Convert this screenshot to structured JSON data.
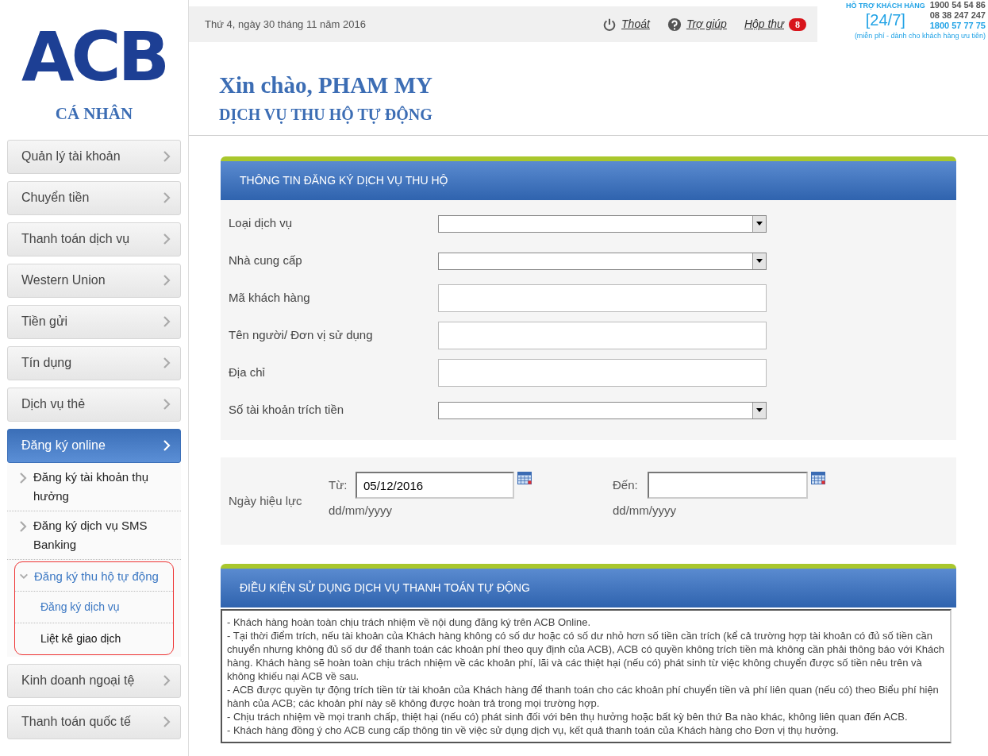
{
  "logo": {
    "text": "ACB",
    "caption": "CÁ NHÂN"
  },
  "top_bar": {
    "date": "Thứ 4, ngày 30 tháng 11 năm 2016",
    "links": [
      {
        "kind": "logout",
        "label": "Thoát"
      },
      {
        "kind": "help",
        "label": "Trợ giúp"
      },
      {
        "kind": "inbox",
        "label": "Hộp thư",
        "badge": "8"
      }
    ],
    "hotline": {
      "title": "HỖ TRỢ KHÁCH HÀNG",
      "hours": "[24/7]",
      "phones": [
        "1900 54 54 86",
        "08 38 247 247",
        "1800 57 77 75"
      ],
      "note": "(miễn phí - dành cho khách hàng ưu tiên)"
    }
  },
  "sidebar": {
    "items": [
      {
        "label": "Quản lý tài khoản",
        "selected": false
      },
      {
        "label": "Chuyển tiền",
        "selected": false
      },
      {
        "label": "Thanh toán dịch vụ",
        "selected": false
      },
      {
        "label": "Western Union",
        "selected": false
      },
      {
        "label": "Tiền gửi",
        "selected": false
      },
      {
        "label": "Tín dụng",
        "selected": false
      },
      {
        "label": "Dịch vụ thẻ",
        "selected": false
      },
      {
        "label": "Đăng ký online",
        "selected": true,
        "children": [
          {
            "label": "Đăng ký tài khoản thụ hưởng",
            "expanded": false,
            "highlighted": false
          },
          {
            "label": "Đăng ký dịch vụ SMS Banking",
            "expanded": false,
            "highlighted": false
          },
          {
            "label": "Đăng ký thu hộ tự động",
            "expanded": true,
            "highlighted": true,
            "children": [
              {
                "label": "Đăng ký dịch vụ",
                "selected": true
              },
              {
                "label": "Liệt kê giao dịch",
                "selected": false
              }
            ]
          }
        ]
      },
      {
        "label": "Kinh doanh ngoại tệ",
        "selected": false
      },
      {
        "label": "Thanh toán quốc tế",
        "selected": false
      }
    ]
  },
  "greeting": "Xin chào, PHAM MY",
  "page_title": "DỊCH VỤ THU HỘ TỰ ĐỘNG",
  "form": {
    "title": "THÔNG TIN ĐĂNG KÝ DỊCH VỤ THU HỘ",
    "fields": [
      {
        "label": "Loại dịch vụ",
        "kind": "select"
      },
      {
        "label": "Nhà cung cấp",
        "kind": "select"
      },
      {
        "label": "Mã khách hàng",
        "kind": "text"
      },
      {
        "label": "Tên người/ Đơn vị sử dụng",
        "kind": "text"
      },
      {
        "label": "Địa chỉ",
        "kind": "text"
      },
      {
        "label": "Số tài khoản trích tiền",
        "kind": "select"
      }
    ]
  },
  "effective_date": {
    "label": "Ngày hiệu lực",
    "from": {
      "label": "Từ:",
      "value": "05/12/2016",
      "hint": "dd/mm/yyyy"
    },
    "to": {
      "label": "Đến:",
      "hint": "dd/mm/yyyy"
    }
  },
  "terms": {
    "title": "ĐIỀU KIỆN SỬ DỤNG DỊCH VỤ THANH TOÁN TỰ ĐỘNG",
    "paragraphs": [
      "-  Khách hàng hoàn toàn chịu trách nhiệm về nội dung đăng ký trên ACB Online.",
      "-  Tại thời điểm trích, nếu tài khoản của Khách hàng không có số dư hoặc có số dư nhỏ hơn số tiền cần trích (kể cả trường hợp tài khoản có đủ số tiền cần chuyển nhưng không đủ số dư để thanh toán các khoản phí theo quy định của ACB), ACB có quyền không trích tiền mà không cần phải thông báo với Khách hàng. Khách hàng sẽ hoàn toàn chịu trách nhiệm về các khoản phí, lãi và các thiệt hại (nếu có) phát sinh từ việc không chuyển được số tiền nêu trên và không khiếu nại ACB về sau.",
      "-  ACB được quyền tự động trích tiền từ tài khoản của Khách hàng để thanh toán cho các khoản phí chuyển tiền và phí liên quan (nếu có) theo Biểu phí hiện hành của ACB; các khoản phí này sẽ không được hoàn trả trong mọi trường hợp.",
      "-  Chịu trách nhiệm về mọi tranh chấp, thiệt hại (nếu có) phát sinh đối với bên thụ hưởng hoặc bất kỳ bên thứ Ba nào khác, không liên quan đến ACB.",
      "-  Khách hàng đồng ý cho ACB cung cấp thông tin về việc sử dụng dịch vụ, kết quả thanh toán của Khách hàng cho Đơn vị thụ hưởng."
    ]
  }
}
